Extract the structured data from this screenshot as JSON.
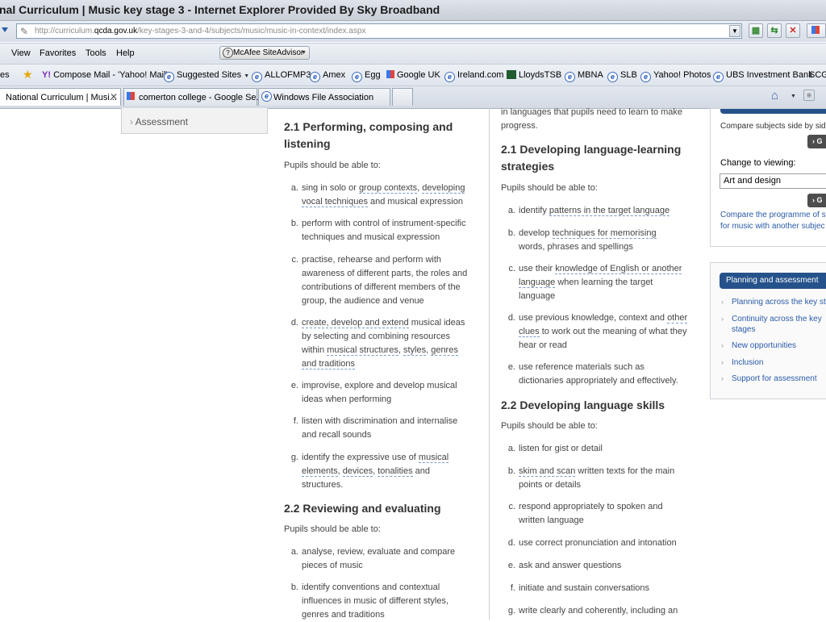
{
  "window": {
    "title": "nal Curriculum | Music key stage 3 - Internet Explorer Provided By Sky Broadband"
  },
  "address": {
    "url_host_prefix": "http://curriculum.",
    "url_host": "qcda.gov.uk",
    "url_path": "/key-stages-3-and-4/subjects/music/music-in-context/index.aspx"
  },
  "menu": {
    "items": [
      "View",
      "Favorites",
      "Tools",
      "Help"
    ],
    "mcafee": "McAfee SiteAdvisor"
  },
  "favorites": {
    "items": [
      "es",
      "Compose Mail - 'Yahoo! Mail'",
      "Suggested Sites",
      "ALLOFMP3",
      "Amex",
      "Egg",
      "Google UK",
      "Ireland.com",
      "LloydsTSB",
      "MBNA",
      "SLB",
      "Yahoo! Photos",
      "UBS Investment Bank",
      "SCG"
    ]
  },
  "tabs": [
    "National Curriculum | Musi...",
    "comerton college - Google Se...",
    "Windows File Association"
  ],
  "leftnav": {
    "item": "Assessment"
  },
  "col1": {
    "h1": "2.1 Performing, composing and listening",
    "intro1": "Pupils should be able to:",
    "items1": [
      {
        "k": "a.",
        "l1a": "sing in solo or ",
        "l1b": "group contexts",
        "l1c": ", ",
        "l1d": "developing",
        "l2a": "vocal techniques",
        "l2b": " and musical expression"
      },
      {
        "k": "b.",
        "l1": "perform with control of instrument-specific",
        "l2": "techniques and musical expression"
      },
      {
        "k": "c.",
        "l1": "practise, rehearse and perform with",
        "l2": "awareness of different parts, the roles and",
        "l3": "contributions of different members of the",
        "l4": "group, the audience and venue"
      },
      {
        "k": "d.",
        "l1a": "create, develop and extend",
        "l1b": " musical ideas",
        "l2": "by selecting and combining resources",
        "l3a": "within ",
        "l3b": "musical structures",
        "l3c": ", ",
        "l3d": "styles",
        "l3e": ", ",
        "l3f": "genres",
        "l4": "and traditions"
      },
      {
        "k": "e.",
        "l1": "improvise, explore and develop musical",
        "l2": "ideas when performing"
      },
      {
        "k": "f.",
        "l1": "listen with discrimination and internalise",
        "l2": "and recall sounds"
      },
      {
        "k": "g.",
        "l1a": "identify the expressive use of ",
        "l1b": "musical",
        "l2a": "elements",
        "l2b": ", ",
        "l2c": "devices",
        "l2d": ", ",
        "l2e": "tonalities",
        "l2f": " and",
        "l3": "structures."
      }
    ],
    "h2": "2.2 Reviewing and evaluating",
    "intro2": "Pupils should be able to:",
    "items2": [
      {
        "k": "a.",
        "l1": "analyse, review, evaluate and compare",
        "l2": "pieces of music"
      },
      {
        "k": "b.",
        "l1": "identify conventions and contextual",
        "l2": "influences in music of different styles,",
        "l3": "genres and traditions"
      }
    ]
  },
  "col2": {
    "top_partial_1": "in languages that pupils need to learn to make",
    "top_partial_2": "progress.",
    "h1": "2.1 Developing language-learning strategies",
    "intro1": "Pupils should be able to:",
    "items1": [
      {
        "k": "a.",
        "l1a": "identify ",
        "l1b": "patterns in the target language"
      },
      {
        "k": "b.",
        "l1a": "develop ",
        "l1b": "techniques for memorising",
        "l2": "words, phrases and spellings"
      },
      {
        "k": "c.",
        "l1a": "use their ",
        "l1b": "knowledge of English or another",
        "l2a": "language",
        "l2b": " when learning the target",
        "l3": "language"
      },
      {
        "k": "d.",
        "l1a": "use previous knowledge, context and ",
        "l1b": "other",
        "l2a": "clues",
        "l2b": " to work out the meaning of what they",
        "l3": "hear or read"
      },
      {
        "k": "e.",
        "l1": "use reference materials such as",
        "l2": "dictionaries appropriately and effectively."
      }
    ],
    "h2": "2.2 Developing language skills",
    "intro2": "Pupils should be able to:",
    "items2": [
      {
        "k": "a.",
        "l1": "listen for gist or detail"
      },
      {
        "k": "b.",
        "l1a": "skim and scan",
        "l1b": " written texts for the main",
        "l2": "points or details"
      },
      {
        "k": "c.",
        "l1": "respond appropriately to spoken and",
        "l2": "written language"
      },
      {
        "k": "d.",
        "l1": "use correct pronunciation and intonation"
      },
      {
        "k": "e.",
        "l1": "ask and answer questions"
      },
      {
        "k": "f.",
        "l1": "initiate and sustain conversations"
      },
      {
        "k": "g.",
        "l1": "write clearly and coherently, including an"
      }
    ]
  },
  "sidebar": {
    "compare_label": "Compare subjects side by sid",
    "go1": "› G",
    "change_label": "Change to viewing:",
    "select_value": "Art and design",
    "go2": "› G",
    "compare_link_1": "Compare the programme of st",
    "compare_link_2": "for music with another subjec",
    "planning_header": "Planning and assessment",
    "planning_links": [
      {
        "l1": "Planning across the key st"
      },
      {
        "l1": "Continuity across the key",
        "l2": "stages"
      },
      {
        "l1": "New opportunities"
      },
      {
        "l1": "Inclusion"
      },
      {
        "l1": "Support for assessment"
      }
    ]
  }
}
